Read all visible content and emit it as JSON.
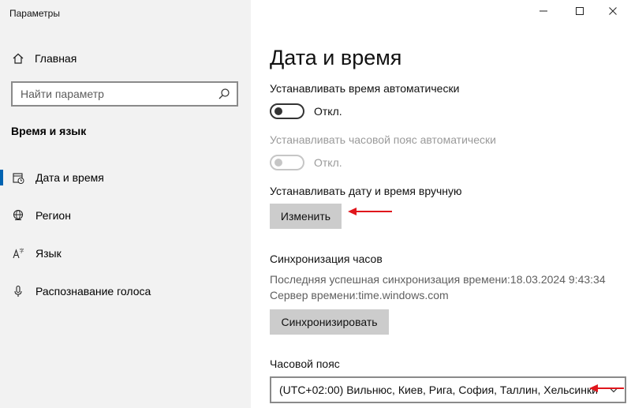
{
  "window": {
    "title": "Параметры",
    "accent_color": "#0063b1",
    "controls": [
      "minimize-icon",
      "maximize-icon",
      "close-icon"
    ]
  },
  "sidebar": {
    "home_label": "Главная",
    "search_placeholder": "Найти параметр",
    "section_title": "Время и язык",
    "items": [
      {
        "label": "Дата и время",
        "icon": "clock-icon",
        "selected": true
      },
      {
        "label": "Регион",
        "icon": "globe-icon",
        "selected": false
      },
      {
        "label": "Язык",
        "icon": "language-icon",
        "selected": false
      },
      {
        "label": "Распознавание голоса",
        "icon": "microphone-icon",
        "selected": false
      }
    ]
  },
  "main": {
    "title": "Дата и время",
    "auto_time": {
      "label": "Устанавливать время автоматически",
      "state": "Откл."
    },
    "auto_timezone": {
      "label": "Устанавливать часовой пояс автоматически",
      "state": "Откл."
    },
    "manual": {
      "label": "Устанавливать дату и время вручную",
      "button": "Изменить"
    },
    "sync": {
      "title": "Синхронизация часов",
      "last_sync": "Последняя успешная синхронизация времени:18.03.2024 9:43:34",
      "server": "Сервер времени:time.windows.com",
      "button": "Синхронизировать"
    },
    "timezone": {
      "label": "Часовой пояс",
      "value": "(UTC+02:00) Вильнюс, Киев, Рига, София, Таллин, Хельсинки"
    }
  },
  "annotations": {
    "arrow_color": "#e0161c"
  }
}
